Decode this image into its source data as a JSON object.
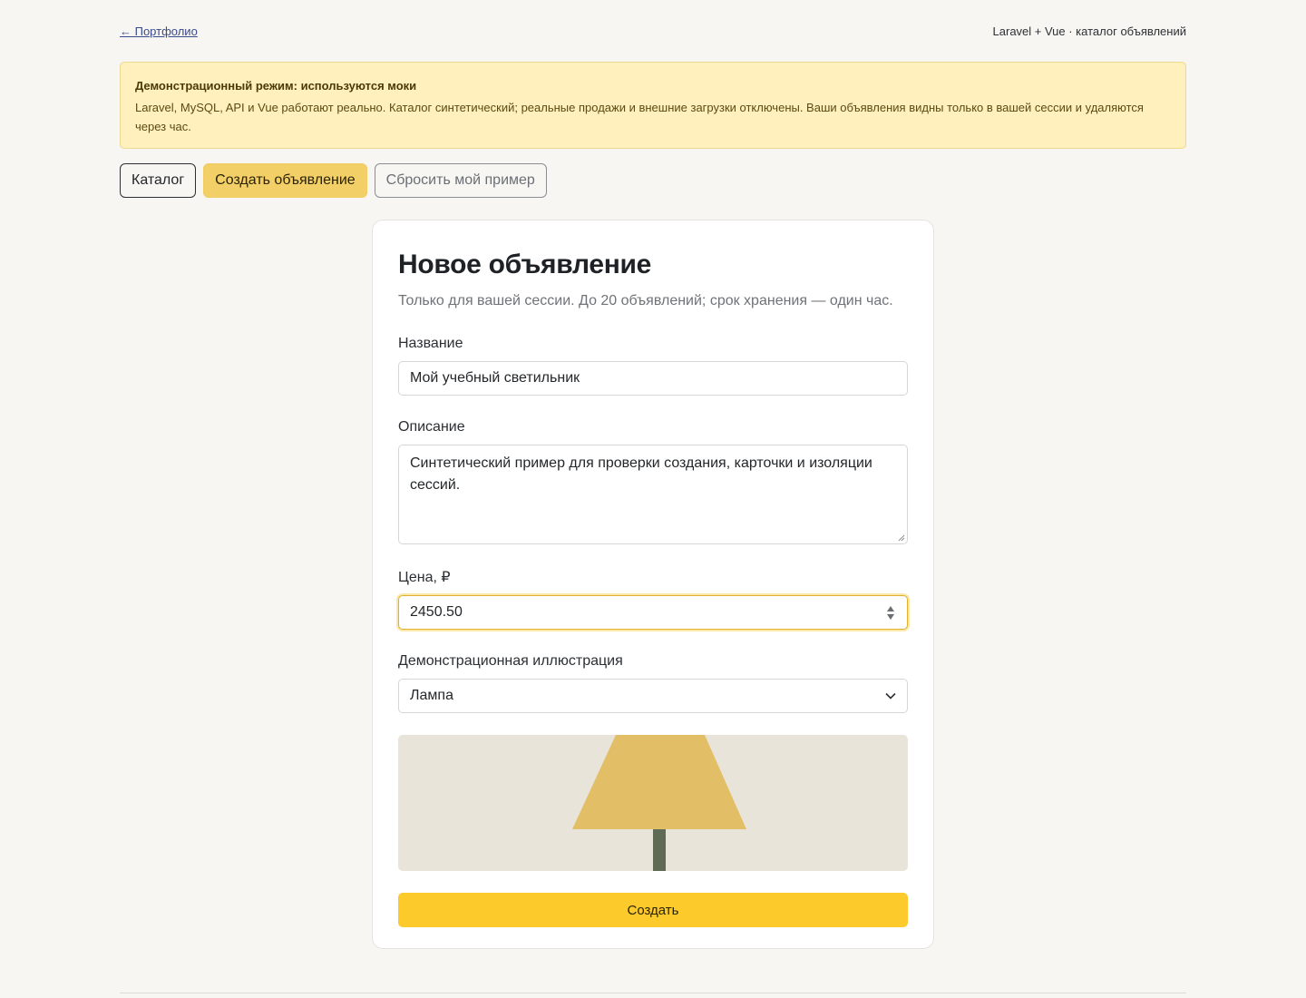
{
  "topbar": {
    "back_link": "← Портфолио",
    "caption": "Laravel + Vue · каталог объявлений"
  },
  "banner": {
    "title": "Демонстрационный режим: используются моки",
    "text": "Laravel, MySQL, API и Vue работают реально. Каталог синтетический; реальные продажи и внешние загрузки отключены. Ваши объявления видны только в вашей сессии и удаляются через час."
  },
  "nav": {
    "catalog": "Каталог",
    "create": "Создать объявление",
    "reset": "Сбросить мой пример"
  },
  "form": {
    "title": "Новое объявление",
    "subtitle": "Только для вашей сессии. До 20 объявлений; срок хранения — один час.",
    "name_label": "Название",
    "name_value": "Мой учебный светильник",
    "description_label": "Описание",
    "description_value": "Синтетический пример для проверки создания, карточки и изоляции сессий.",
    "price_label": "Цена, ₽",
    "price_value": "2450.50",
    "illustration_label": "Демонстрационная иллюстрация",
    "illustration_value": "Лампа",
    "submit": "Создать"
  },
  "icons": {
    "select_arrow": "chevron-down-icon",
    "spinner": "number-spinner-icon",
    "illustration": "lamp-illustration"
  },
  "colors": {
    "background": "#f7f6f2",
    "banner_bg": "#fff0bd",
    "accent": "#f3cf68",
    "submit": "#fdca2c",
    "lamp_shade": "#e2bf66",
    "lamp_stem": "#5f6b55",
    "illustration_bg": "#e8e4d9"
  }
}
